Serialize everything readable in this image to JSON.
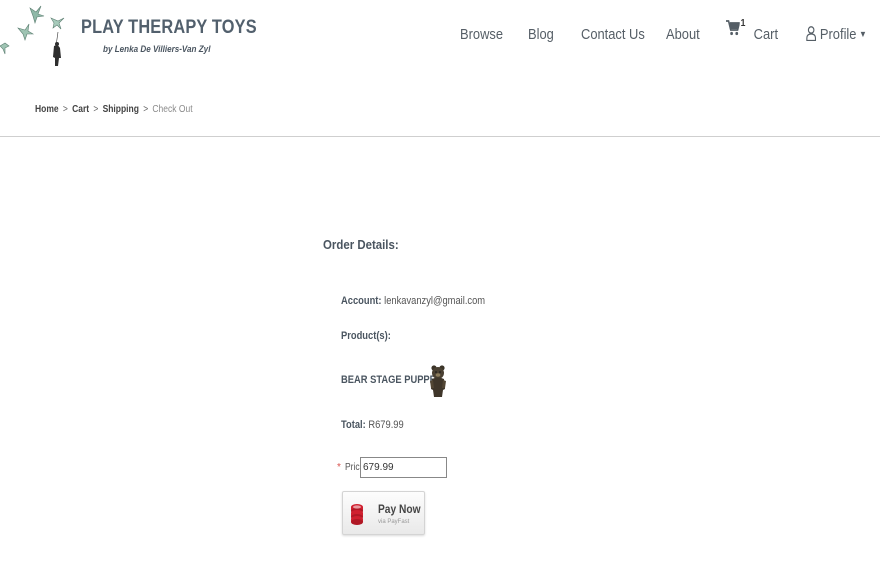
{
  "brand": {
    "title": "PLAY THERAPY TOYS",
    "subtitle": "by Lenka De Villiers-Van Zyl"
  },
  "nav": {
    "browse": "Browse",
    "blog": "Blog",
    "contact": "Contact Us",
    "about": "About",
    "cart_label": "Cart",
    "cart_count": "1",
    "profile": "Profile"
  },
  "breadcrumb": {
    "items": [
      "Home",
      "Cart",
      "Shipping"
    ],
    "current": "Check Out",
    "separator": ">"
  },
  "order": {
    "title": "Order Details:",
    "account_label": "Account:",
    "account_value": "lenkavanzyl@gmail.com",
    "products_label": "Product(s):",
    "product_name": "BEAR STAGE PUPPET",
    "total_label": "Total:",
    "total_value": "R679.99",
    "price_required": "*",
    "price_label": "Price",
    "price_value": "679.99"
  },
  "payment": {
    "button_main": "Pay Now",
    "button_sub": "via PayFast"
  },
  "colors": {
    "brand_text": "#52606d",
    "divider": "#cfcfcf",
    "required": "#d9534f",
    "payfast_red": "#d0202f"
  },
  "icons": {
    "cart": "cart-icon",
    "profile": "user-icon",
    "caret": "caret-down-icon",
    "payfast": "coin-stack-icon"
  }
}
